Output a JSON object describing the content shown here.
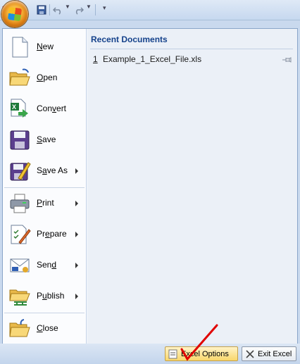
{
  "menu": {
    "items": [
      {
        "label": "New",
        "mnemonic": "N",
        "has_submenu": false,
        "icon": "new-document-icon"
      },
      {
        "label": "Open",
        "mnemonic": "O",
        "has_submenu": false,
        "icon": "open-folder-icon"
      },
      {
        "label": "Convert",
        "mnemonic": "v",
        "has_submenu": false,
        "icon": "convert-icon"
      },
      {
        "label": "Save",
        "mnemonic": "S",
        "has_submenu": false,
        "icon": "save-disk-icon"
      },
      {
        "label": "Save As",
        "mnemonic": "A",
        "has_submenu": true,
        "icon": "save-as-icon"
      },
      {
        "label": "Print",
        "mnemonic": "P",
        "has_submenu": true,
        "icon": "printer-icon"
      },
      {
        "label": "Prepare",
        "mnemonic": "E",
        "has_submenu": true,
        "icon": "prepare-icon"
      },
      {
        "label": "Send",
        "mnemonic": "D",
        "has_submenu": true,
        "icon": "send-icon"
      },
      {
        "label": "Publish",
        "mnemonic": "U",
        "has_submenu": true,
        "icon": "publish-icon"
      },
      {
        "label": "Close",
        "mnemonic": "C",
        "has_submenu": false,
        "icon": "close-folder-icon"
      }
    ]
  },
  "recent": {
    "title": "Recent Documents",
    "items": [
      {
        "number": "1",
        "name": "Example_1_Excel_File.xls"
      }
    ]
  },
  "buttons": {
    "options_label": "Excel Options",
    "exit_label": "Exit Excel"
  },
  "colors": {
    "accent": "#15428b",
    "annotation_red": "#e00000"
  }
}
